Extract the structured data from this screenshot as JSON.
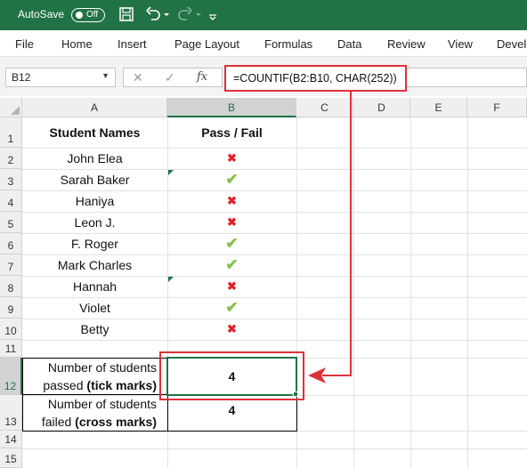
{
  "titlebar": {
    "autosave_label": "AutoSave",
    "autosave_state": "Off"
  },
  "menu": [
    "File",
    "Home",
    "Insert",
    "Page Layout",
    "Formulas",
    "Data",
    "Review",
    "View",
    "Develo"
  ],
  "formula_bar": {
    "name_box": "B12",
    "cancel": "✕",
    "enter": "✓",
    "fx": "fx",
    "formula": "=COUNTIF(B2:B10, CHAR(252))"
  },
  "columns": [
    "A",
    "B",
    "C",
    "D",
    "E",
    "F"
  ],
  "rows": [
    "1",
    "2",
    "3",
    "4",
    "5",
    "6",
    "7",
    "8",
    "9",
    "10",
    "11",
    "12",
    "13",
    "14",
    "15"
  ],
  "table": {
    "header_names": "Student Names",
    "header_result": "Pass / Fail",
    "students": [
      {
        "name": "John Elea",
        "result": "✖"
      },
      {
        "name": "Sarah Baker",
        "result": "✔"
      },
      {
        "name": "Haniya",
        "result": "✖"
      },
      {
        "name": "Leon J.",
        "result": "✖"
      },
      {
        "name": "F. Roger",
        "result": "✔"
      },
      {
        "name": "Mark Charles",
        "result": "✔"
      },
      {
        "name": "Hannah",
        "result": "✖"
      },
      {
        "name": "Violet",
        "result": "✔"
      },
      {
        "name": "Betty",
        "result": "✖"
      }
    ]
  },
  "summary": {
    "passed_line1": "Number of students",
    "passed_line2_prefix": "passed ",
    "passed_line2_bold": "(tick marks)",
    "passed_value": "4",
    "failed_line1": "Number of students",
    "failed_line2_prefix": "failed ",
    "failed_line2_bold": "(cross marks)",
    "failed_value": "4"
  },
  "colors": {
    "excel_green": "#217346",
    "tick": "#82c34a",
    "cross": "#e0222c",
    "annotation": "#e0303a"
  }
}
